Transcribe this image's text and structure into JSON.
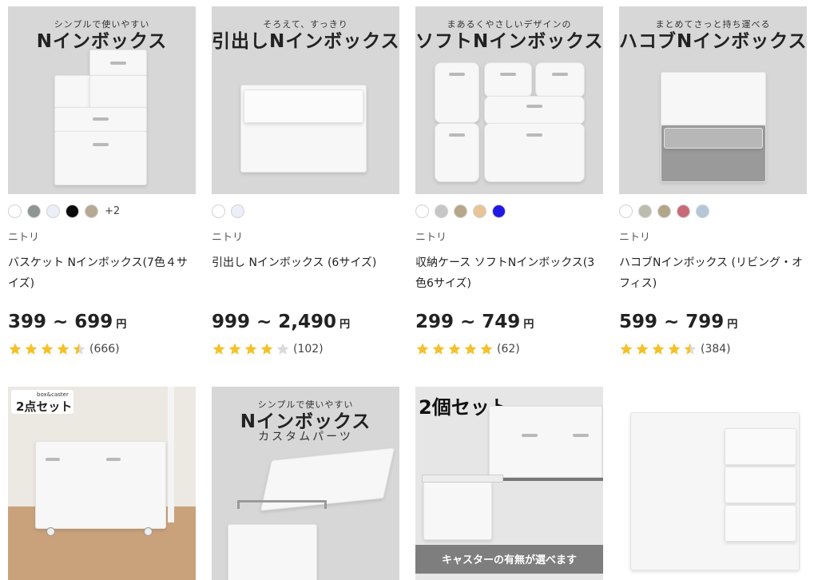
{
  "colors": {
    "star": "#f5c02a",
    "star_empty": "#dadada"
  },
  "products": [
    {
      "image": {
        "subtitle": "シンプルで使いやすい",
        "title": "Nインボックス"
      },
      "swatches": [
        "#ffffff",
        "#8f9593",
        "#eceff8",
        "#0b0b0b",
        "#b6a891"
      ],
      "more_colors": "+2",
      "brand": "ニトリ",
      "name": "バスケット Nインボックス(7色４サイズ)",
      "price_range": "399 ~ 699",
      "currency": "円",
      "rating": 4.5,
      "review_count": "(666)"
    },
    {
      "image": {
        "subtitle": "そろえて、すっきり",
        "title": "引出しNインボックス"
      },
      "swatches": [
        "#ffffff",
        "#eceff8"
      ],
      "brand": "ニトリ",
      "name": "引出し Nインボックス (6サイズ)",
      "price_range": "999 ~ 2,490",
      "currency": "円",
      "rating": 4,
      "review_count": "(102)"
    },
    {
      "image": {
        "subtitle": "まあるくやさしいデザインの",
        "title": "ソフトNインボックス"
      },
      "swatches": [
        "#ffffff",
        "#c6c6c6",
        "#b6a68a",
        "#e8c496",
        "#1f17e6"
      ],
      "brand": "ニトリ",
      "name": "収納ケース ソフトNインボックス(3色6サイズ)",
      "price_range": "299 ~ 749",
      "currency": "円",
      "rating": 5,
      "review_count": "(62)"
    },
    {
      "image": {
        "subtitle": "まとめてさっと持ち運べる",
        "title": "ハコブNインボックス"
      },
      "swatches": [
        "#ffffff",
        "#bcbcae",
        "#b3a58b",
        "#c86a78",
        "#b5c6d8"
      ],
      "brand": "ニトリ",
      "name": "ハコブNインボックス (リビング・オフィス)",
      "price_range": "599 ~ 799",
      "currency": "円",
      "rating": 4.5,
      "review_count": "(384)"
    }
  ],
  "row2": [
    {
      "badge_small": "box&caster",
      "badge": "2点セット"
    },
    {
      "subtitle": "シンプルで使いやすい",
      "title": "Nインボックス",
      "caption": "カスタムパーツ"
    },
    {
      "badge": "2個セット",
      "banner": "キャスターの有無が選べます"
    },
    {}
  ]
}
